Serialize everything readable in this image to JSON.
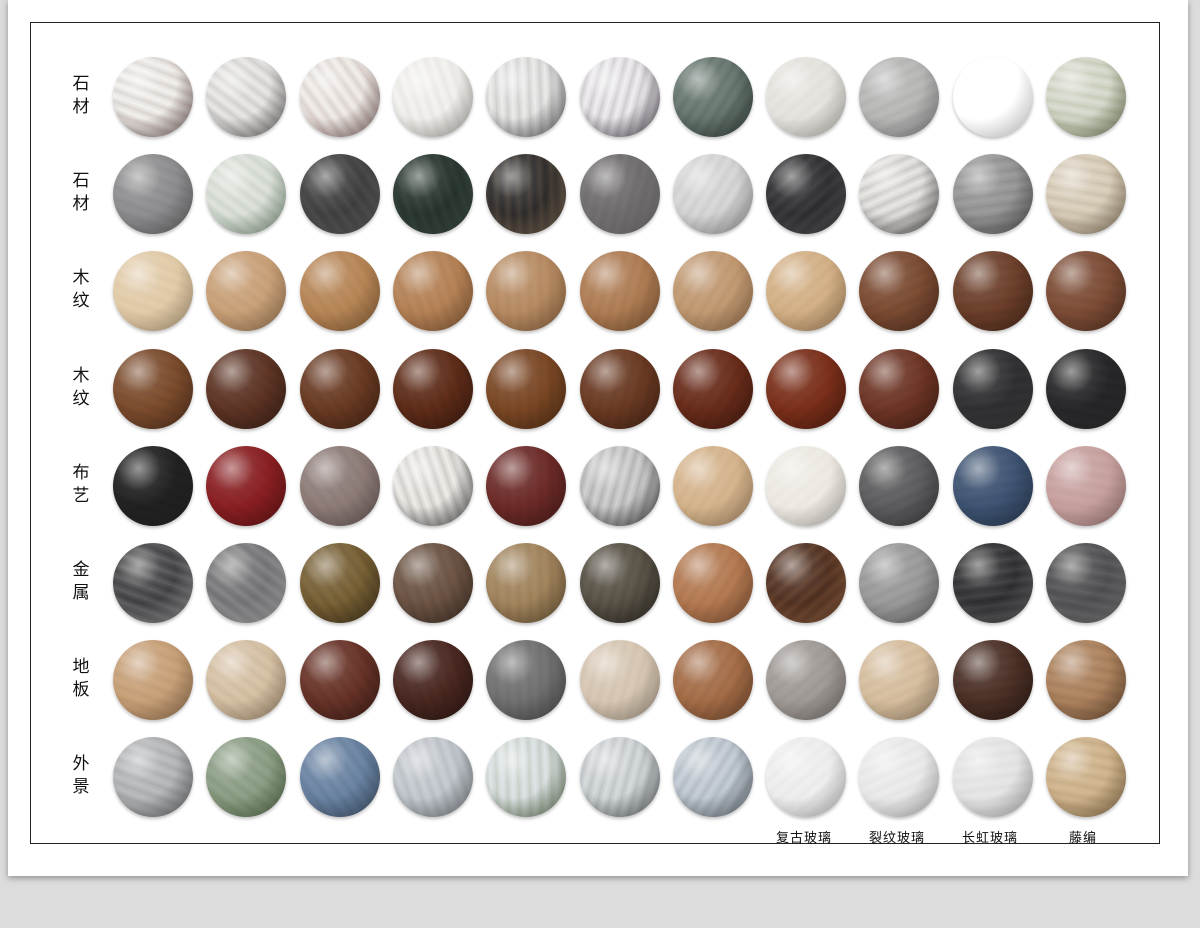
{
  "rows": [
    {
      "label": "石材",
      "materials": [
        {
          "name": "white-marble-sphere",
          "base": "#f2f1ee",
          "accent": "#6d4f4a"
        },
        {
          "name": "white-marble-sphere",
          "base": "#e9e8e6",
          "accent": "#5a5656"
        },
        {
          "name": "white-marble-sphere",
          "base": "#f1eeea",
          "accent": "#7a5552"
        },
        {
          "name": "white-marble-sphere",
          "base": "#f3f2ef",
          "accent": "#b9b5ae"
        },
        {
          "name": "white-marble-sphere",
          "base": "#ebebea",
          "accent": "#4f4d4e"
        },
        {
          "name": "violet-marble-sphere",
          "base": "#efedef",
          "accent": "#3f3646"
        },
        {
          "name": "green-marble-sphere",
          "base": "#6a7a72",
          "accent": "#2e3a36"
        },
        {
          "name": "beige-stone-sphere",
          "base": "#e6e4df",
          "accent": "#c9c6bf"
        },
        {
          "name": "grey-marble-sphere",
          "base": "#b9b9b8",
          "accent": "#8a8a8a"
        },
        {
          "name": "white-marble-sphere",
          "base": "#efeeec",
          "accent": "#555"
        },
        {
          "name": "green-onyx-sphere",
          "base": "#d9dcd0",
          "accent": "#6f7b4a"
        }
      ]
    },
    {
      "label": "石材",
      "materials": [
        {
          "name": "grey-marble-sphere",
          "base": "#8f8f91",
          "accent": "#6a6a6c"
        },
        {
          "name": "green-marble-sphere",
          "base": "#dfe2dc",
          "accent": "#7a9a7e"
        },
        {
          "name": "black-marble-sphere",
          "base": "#3b3b3c",
          "accent": "#7a7a7a"
        },
        {
          "name": "dark-green-marble-sphere",
          "base": "#233029",
          "accent": "#4f6458"
        },
        {
          "name": "black-gold-marble-sphere",
          "base": "#2a2828",
          "accent": "#a08668"
        },
        {
          "name": "grey-marble-sphere",
          "base": "#6b686a",
          "accent": "#8d8a8c"
        },
        {
          "name": "light-grey-marble-sphere",
          "base": "#d7d8d7",
          "accent": "#9a9c9b"
        },
        {
          "name": "black-marble-sphere",
          "base": "#2b2b2d",
          "accent": "#6b6b70"
        },
        {
          "name": "terrazzo-sphere",
          "base": "#e8e6e3",
          "accent": "#3a3a3a"
        },
        {
          "name": "terrazzo-sphere",
          "base": "#9a9a9a",
          "accent": "#4d4d4d"
        },
        {
          "name": "terrazzo-sphere",
          "base": "#dbd1be",
          "accent": "#8a7558"
        }
      ]
    },
    {
      "label": "木纹",
      "materials": [
        {
          "name": "light-wood-sphere",
          "base": "#e2ccaa",
          "accent": "#c9ad87"
        },
        {
          "name": "light-wood-sphere",
          "base": "#caa27a",
          "accent": "#a77f57"
        },
        {
          "name": "oak-wood-sphere",
          "base": "#b88758",
          "accent": "#946637"
        },
        {
          "name": "oak-wood-sphere",
          "base": "#b68357",
          "accent": "#8e5e36"
        },
        {
          "name": "oak-wood-sphere",
          "base": "#b88c63",
          "accent": "#956a43"
        },
        {
          "name": "oak-wood-sphere",
          "base": "#b07e55",
          "accent": "#8a5c35"
        },
        {
          "name": "oak-wood-sphere",
          "base": "#c29a73",
          "accent": "#9d7650"
        },
        {
          "name": "light-wood-sphere",
          "base": "#d4b288",
          "accent": "#b58e62"
        },
        {
          "name": "walnut-wood-sphere",
          "base": "#7c4b32",
          "accent": "#5a3322"
        },
        {
          "name": "walnut-wood-sphere",
          "base": "#6d3f2a",
          "accent": "#4c2a1a"
        },
        {
          "name": "walnut-wood-sphere",
          "base": "#7e4d36",
          "accent": "#5b3424"
        }
      ]
    },
    {
      "label": "木纹",
      "materials": [
        {
          "name": "walnut-wood-sphere",
          "base": "#7c4c2c",
          "accent": "#5a3320"
        },
        {
          "name": "walnut-wood-sphere",
          "base": "#5e3424",
          "accent": "#3e2117"
        },
        {
          "name": "walnut-wood-sphere",
          "base": "#6a3a22",
          "accent": "#4a2716"
        },
        {
          "name": "rosewood-sphere",
          "base": "#5f2c18",
          "accent": "#3f1c10"
        },
        {
          "name": "walnut-wood-sphere",
          "base": "#7b4724",
          "accent": "#573117"
        },
        {
          "name": "walnut-wood-sphere",
          "base": "#6b3a22",
          "accent": "#4a2616"
        },
        {
          "name": "rosewood-sphere",
          "base": "#6a2c1a",
          "accent": "#491c10"
        },
        {
          "name": "cherry-wood-sphere",
          "base": "#7b2f1a",
          "accent": "#5a1f10"
        },
        {
          "name": "walnut-wood-sphere",
          "base": "#6e3525",
          "accent": "#4d2318"
        },
        {
          "name": "black-wood-sphere",
          "base": "#2c2c2e",
          "accent": "#4a4a4c"
        },
        {
          "name": "black-wood-sphere",
          "base": "#232325",
          "accent": "#3a3a3c"
        }
      ]
    },
    {
      "label": "布艺",
      "materials": [
        {
          "name": "black-fabric-sphere",
          "base": "#1e1e1f",
          "accent": "#2e2e30"
        },
        {
          "name": "red-fabric-sphere",
          "base": "#8a1f22",
          "accent": "#6a1418"
        },
        {
          "name": "taupe-fabric-sphere",
          "base": "#8e7c78",
          "accent": "#6e5e5a"
        },
        {
          "name": "white-embroidered-fabric-sphere",
          "base": "#efece8",
          "accent": "#3a3a3a"
        },
        {
          "name": "burgundy-fabric-sphere",
          "base": "#6d2b28",
          "accent": "#4f1c1a"
        },
        {
          "name": "houndstooth-fabric-sphere",
          "base": "#cfcfcf",
          "accent": "#2a2a2a"
        },
        {
          "name": "beige-fabric-sphere",
          "base": "#d6b58e",
          "accent": "#b8956d"
        },
        {
          "name": "cream-fabric-sphere",
          "base": "#eeeae4",
          "accent": "#d8d2c8"
        },
        {
          "name": "knit-grey-fabric-sphere",
          "base": "#5e5e60",
          "accent": "#3e3e40"
        },
        {
          "name": "blue-fabric-sphere",
          "base": "#3e5473",
          "accent": "#2b3c55"
        },
        {
          "name": "pink-fabric-sphere",
          "base": "#c8a2a0",
          "accent": "#a9807e"
        }
      ]
    },
    {
      "label": "金属",
      "materials": [
        {
          "name": "chrome-metal-sphere",
          "base": "#3c3c3e",
          "accent": "#c9c9cb"
        },
        {
          "name": "hammered-metal-sphere",
          "base": "#6e6e70",
          "accent": "#d8d8da"
        },
        {
          "name": "antique-brass-sphere",
          "base": "#7a6236",
          "accent": "#3e2f18"
        },
        {
          "name": "rusty-metal-sphere",
          "base": "#6e5545",
          "accent": "#3e2e24"
        },
        {
          "name": "brushed-brass-sphere",
          "base": "#a3865e",
          "accent": "#6e5636"
        },
        {
          "name": "bronze-metal-sphere",
          "base": "#5b5448",
          "accent": "#2a2620"
        },
        {
          "name": "copper-metal-sphere",
          "base": "#b57b52",
          "accent": "#8a5636"
        },
        {
          "name": "dark-copper-sphere",
          "base": "#4a2c1e",
          "accent": "#b57a52"
        },
        {
          "name": "brushed-steel-sphere",
          "base": "#9c9c9c",
          "accent": "#6a6a6a"
        },
        {
          "name": "carbon-fiber-sphere",
          "base": "#2a2a2c",
          "accent": "#8a8a8c"
        },
        {
          "name": "ribbed-steel-sphere",
          "base": "#4a4a4c",
          "accent": "#9a9a9c"
        }
      ]
    },
    {
      "label": "地板",
      "materials": [
        {
          "name": "herringbone-floor-sphere",
          "base": "#c9a27a",
          "accent": "#9e7750"
        },
        {
          "name": "light-floor-sphere",
          "base": "#d7c2a6",
          "accent": "#a88f70"
        },
        {
          "name": "herringbone-floor-sphere",
          "base": "#6a3428",
          "accent": "#3e1c16"
        },
        {
          "name": "dark-floor-sphere",
          "base": "#4a2720",
          "accent": "#2e1713"
        },
        {
          "name": "grey-floor-sphere",
          "base": "#727272",
          "accent": "#4e4e4e"
        },
        {
          "name": "chevron-floor-sphere",
          "base": "#d8c8b5",
          "accent": "#b2a18b"
        },
        {
          "name": "chevron-floor-sphere",
          "base": "#a66e48",
          "accent": "#7a4c2e"
        },
        {
          "name": "grey-floor-sphere",
          "base": "#a29c98",
          "accent": "#7e7874"
        },
        {
          "name": "light-floor-sphere",
          "base": "#d7bfa0",
          "accent": "#b29878"
        },
        {
          "name": "dark-floor-sphere",
          "base": "#4c3026",
          "accent": "#2e1c16"
        },
        {
          "name": "striped-floor-sphere",
          "base": "#b08560",
          "accent": "#6a4a30"
        }
      ]
    },
    {
      "label": "外景",
      "materials": [
        {
          "name": "city-landscape-sphere",
          "base": "#b9bbbd",
          "accent": "#5a5c5e"
        },
        {
          "name": "green-landscape-sphere",
          "base": "#8fa08a",
          "accent": "#4f6a3e"
        },
        {
          "name": "mountain-landscape-sphere",
          "base": "#6d86a6",
          "accent": "#3a4f66"
        },
        {
          "name": "city-landscape-sphere",
          "base": "#c7ccd2",
          "accent": "#6e747a"
        },
        {
          "name": "park-landscape-sphere",
          "base": "#dfe3e6",
          "accent": "#4f6a3e"
        },
        {
          "name": "lake-landscape-sphere",
          "base": "#d6dadc",
          "accent": "#4e5558"
        },
        {
          "name": "city-landscape-sphere",
          "base": "#c5cdd6",
          "accent": "#55606a"
        },
        {
          "name": "vintage-glass-sphere",
          "base": "#efefef",
          "accent": "#cfcfcf"
        },
        {
          "name": "cracked-glass-sphere",
          "base": "#ebebeb",
          "accent": "#c8c8c8"
        },
        {
          "name": "fluted-glass-sphere",
          "base": "#e6e6e6",
          "accent": "#bfbfbf"
        },
        {
          "name": "rattan-weave-sphere",
          "base": "#d2b790",
          "accent": "#8a6c44"
        }
      ]
    }
  ],
  "captions": [
    "复古玻璃",
    "裂纹玻璃",
    "长虹玻璃",
    "藤编"
  ]
}
